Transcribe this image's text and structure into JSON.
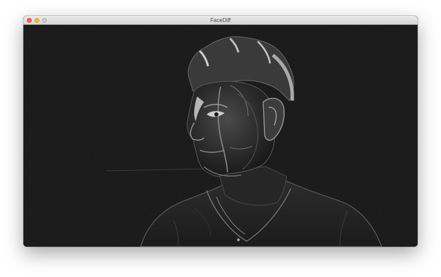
{
  "window": {
    "title": "FaceDiff"
  },
  "controls": {
    "close_icon": "close-icon",
    "minimize_icon": "minimize-icon",
    "zoom_icon": "zoom-icon"
  },
  "colors": {
    "close": "#fc5f57",
    "minimize": "#fdbc2e",
    "zoom_disabled": "#c9c9c9",
    "canvas_background": "#111111"
  }
}
